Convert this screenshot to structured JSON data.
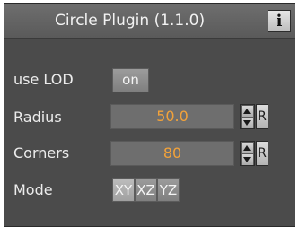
{
  "header": {
    "title": "Circle Plugin (1.1.0)",
    "info_label": "i"
  },
  "lod": {
    "label": "use LOD",
    "toggle": "on"
  },
  "radius": {
    "label": "Radius",
    "value": "50.0",
    "reset": "R"
  },
  "corners": {
    "label": "Corners",
    "value": "80",
    "reset": "R"
  },
  "mode": {
    "label": "Mode",
    "options": [
      "XY",
      "XZ",
      "YZ"
    ],
    "selected": "XY"
  },
  "colors": {
    "panel_bg": "#4b4b4b",
    "value_text": "#f2a23a",
    "label_text": "#ececec"
  }
}
